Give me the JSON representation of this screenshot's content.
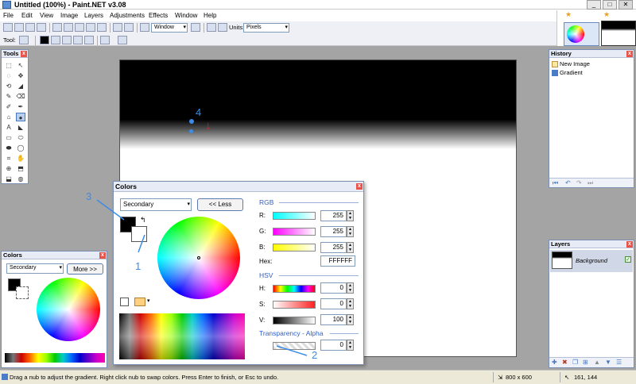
{
  "window": {
    "title": "Untitled (100%) - Paint.NET v3.08",
    "min": "_",
    "max": "□",
    "close": "✕"
  },
  "menu": [
    "File",
    "Edit",
    "View",
    "Image",
    "Layers",
    "Adjustments",
    "Effects",
    "Window",
    "Help"
  ],
  "toolbar": {
    "zoom_value": "Window",
    "units_label": "Units:",
    "units_value": "Pixels",
    "tool_label": "Tool:"
  },
  "tools_panel": {
    "title": "Tools",
    "close": "x",
    "tools": [
      "T1",
      "T2",
      "T3",
      "T4",
      "T5",
      "T6",
      "T7",
      "T8",
      "T9",
      "T10",
      "T11",
      "T12",
      "T13",
      "T14",
      "T15",
      "T16",
      "T17",
      "T18",
      "T19",
      "T20",
      "T21",
      "T22",
      "T23",
      "T24"
    ]
  },
  "history_panel": {
    "title": "History",
    "close": "x",
    "items": [
      "New Image",
      "Gradient"
    ]
  },
  "layers_panel": {
    "title": "Layers",
    "close": "x",
    "layer_name": "Background"
  },
  "colors_small": {
    "title": "Colors",
    "close": "x",
    "mode": "Secondary",
    "more_button": "More >>"
  },
  "colors_big": {
    "title": "Colors",
    "close": "x",
    "mode": "Secondary",
    "less_button": "<< Less",
    "rgb_label": "RGB",
    "r_label": "R:",
    "g_label": "G:",
    "b_label": "B:",
    "r": "255",
    "g": "255",
    "b": "255",
    "hex_label": "Hex:",
    "hex": "FFFFFF",
    "hsv_label": "HSV",
    "h_label": "H:",
    "s_label": "S:",
    "v_label": "V:",
    "h": "0",
    "s": "0",
    "v": "100",
    "alpha_label": "Transparency - Alpha",
    "alpha": "0"
  },
  "annotations": {
    "a1": "1",
    "a2": "2",
    "a3": "3",
    "a4": "4"
  },
  "status": {
    "hint": "Drag a nub to adjust the gradient. Right click nub to swap colors. Press Enter to finish, or Esc to undo.",
    "size": "800 x 600",
    "coords": "161, 144"
  },
  "colors": {
    "accent": "#3a8ce8",
    "panel_border": "#7b8fb3",
    "hsv_blue": "#2e5ec6"
  }
}
